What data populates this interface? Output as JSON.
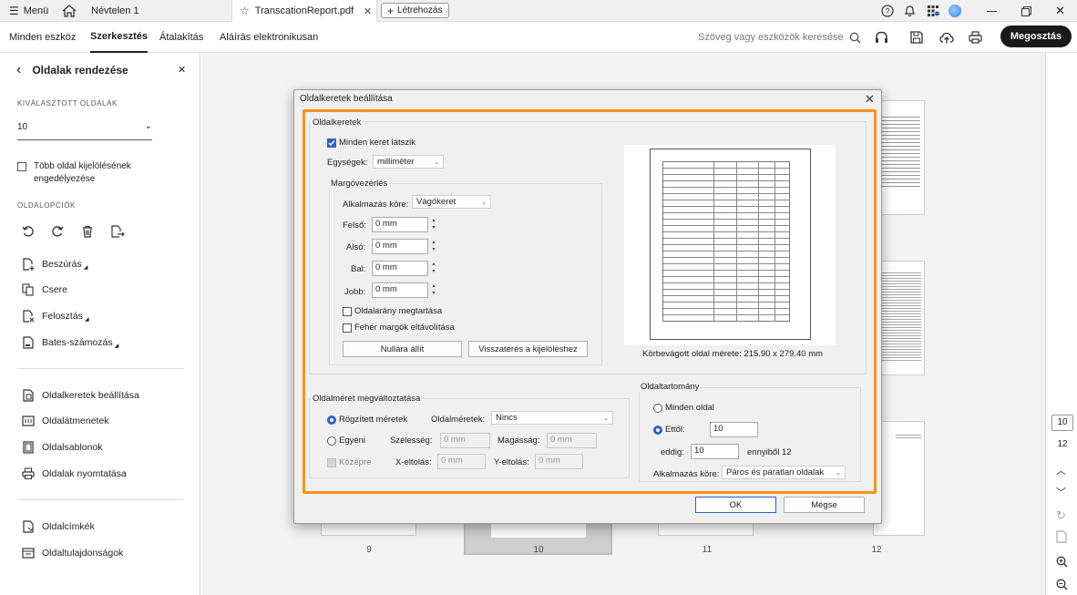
{
  "titlebar": {
    "menu": "Menü",
    "tab1": "Névtelen 1",
    "tab2": "TranscationReport.pdf",
    "new_tab": "Létrehozás"
  },
  "menubar": {
    "items": [
      "Minden eszköz",
      "Szerkesztés",
      "Átalakítás",
      "Aláírás elektronikusan"
    ],
    "search_placeholder": "Szöveg vagy eszközök keresése",
    "share": "Megosztás"
  },
  "sidebar": {
    "title": "Oldalak rendezése",
    "selected_pages_label": "KIVÁLASZTOTT OLDALAK",
    "selected_page_value": "10",
    "multi_select_label": "Több oldal kijelölésének engedélyezése",
    "page_options_label": "OLDALOPCIÓK",
    "tools": [
      "Beszúrás",
      "Csere",
      "Felosztás",
      "Bates-számozás"
    ],
    "group2": [
      "Oldalkeretek beállítása",
      "Oldalátmenetek",
      "Oldalsablonok",
      "Oldalak nyomtatása"
    ],
    "group3": [
      "Oldalcímkék",
      "Oldaltulajdonságok"
    ]
  },
  "canvas": {
    "page_numbers": [
      "9",
      "10",
      "11",
      "12"
    ]
  },
  "rail": {
    "current_page": "10",
    "total_pages": "12"
  },
  "dialog": {
    "title": "Oldalkeretek beállítása",
    "frames_group": "Oldalkeretek",
    "show_all_frames": "Minden keret látszik",
    "units_label": "Egységek:",
    "units_value": "milliméter",
    "margin_group": "Margóvezérlés",
    "apply_to_label": "Alkalmazás köre:",
    "apply_to_value": "Vágókeret",
    "top_label": "Felső:",
    "top_value": "0 mm",
    "bottom_label": "Alsó:",
    "bottom_value": "0 mm",
    "left_label": "Bal:",
    "left_value": "0 mm",
    "right_label": "Jobb:",
    "right_value": "0 mm",
    "keep_ratio": "Oldalarány megtartása",
    "remove_white": "Fehér margók eltávolítása",
    "reset_button": "Nullára állít",
    "revert_button": "Visszatérés a kijelöléshez",
    "cropped_size": "Körbevágott oldal mérete: 215.90 x 279.40 mm",
    "size_group": "Oldalméret megváltoztatása",
    "fixed_sizes": "Rögzített méretek",
    "page_sizes_label": "Oldalméretek:",
    "page_sizes_value": "Nincs",
    "custom": "Egyéni",
    "width_label": "Szélesség:",
    "width_value": "0 mm",
    "height_label": "Magasság:",
    "height_value": "0 mm",
    "center": "Középre",
    "xoffset_label": "X-eltolás:",
    "xoffset_value": "0 mm",
    "yoffset_label": "Y-eltolás:",
    "yoffset_value": "0 mm",
    "range_group": "Oldaltartomány",
    "all_pages": "Minden oldal",
    "from_label": "Ettől:",
    "from_value": "10",
    "to_label": "eddig:",
    "to_value": "10",
    "of_total": "ennyiből 12",
    "apply_scope_label": "Alkalmazás köre:",
    "apply_scope_value": "Páros és páratlan oldalak",
    "ok": "OK",
    "cancel": "Mégse"
  },
  "colors": {
    "highlight": "#f7941d",
    "accent": "#2b62c7"
  }
}
